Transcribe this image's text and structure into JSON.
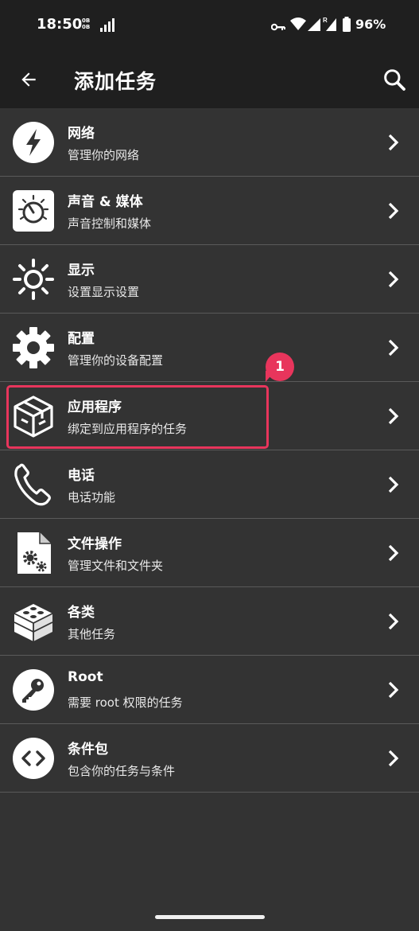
{
  "status_bar": {
    "time": "18:50",
    "small_indicator_top": "0B",
    "small_indicator_bottom": "0B",
    "battery": "96%"
  },
  "app_bar": {
    "title": "添加任务",
    "back_icon": "arrow-left-icon",
    "search_icon": "search-icon"
  },
  "categories": [
    {
      "title": "网络",
      "subtitle": "管理你的网络",
      "icon": "lightning-icon"
    },
    {
      "title": "声音 & 媒体",
      "subtitle": "声音控制和媒体",
      "icon": "volume-knob-icon"
    },
    {
      "title": "显示",
      "subtitle": "设置显示设置",
      "icon": "brightness-icon"
    },
    {
      "title": "配置",
      "subtitle": "管理你的设备配置",
      "icon": "gear-icon"
    },
    {
      "title": "应用程序",
      "subtitle": "绑定到应用程序的任务",
      "icon": "app-cube-icon"
    },
    {
      "title": "电话",
      "subtitle": "电话功能",
      "icon": "phone-icon"
    },
    {
      "title": "文件操作",
      "subtitle": "管理文件和文件夹",
      "icon": "file-gear-icon"
    },
    {
      "title": "各类",
      "subtitle": "其他任务",
      "icon": "blocks-icon"
    },
    {
      "title": "Root",
      "subtitle": "需要 root 权限的任务",
      "icon": "key-icon"
    },
    {
      "title": "条件包",
      "subtitle": "包含你的任务与条件",
      "icon": "code-icon"
    }
  ],
  "annotation": {
    "badge_label": "1",
    "highlight_color": "#e8355c"
  },
  "colors": {
    "background": "#333333",
    "bar": "#1f1f1f",
    "divider": "#5a5a5a"
  }
}
